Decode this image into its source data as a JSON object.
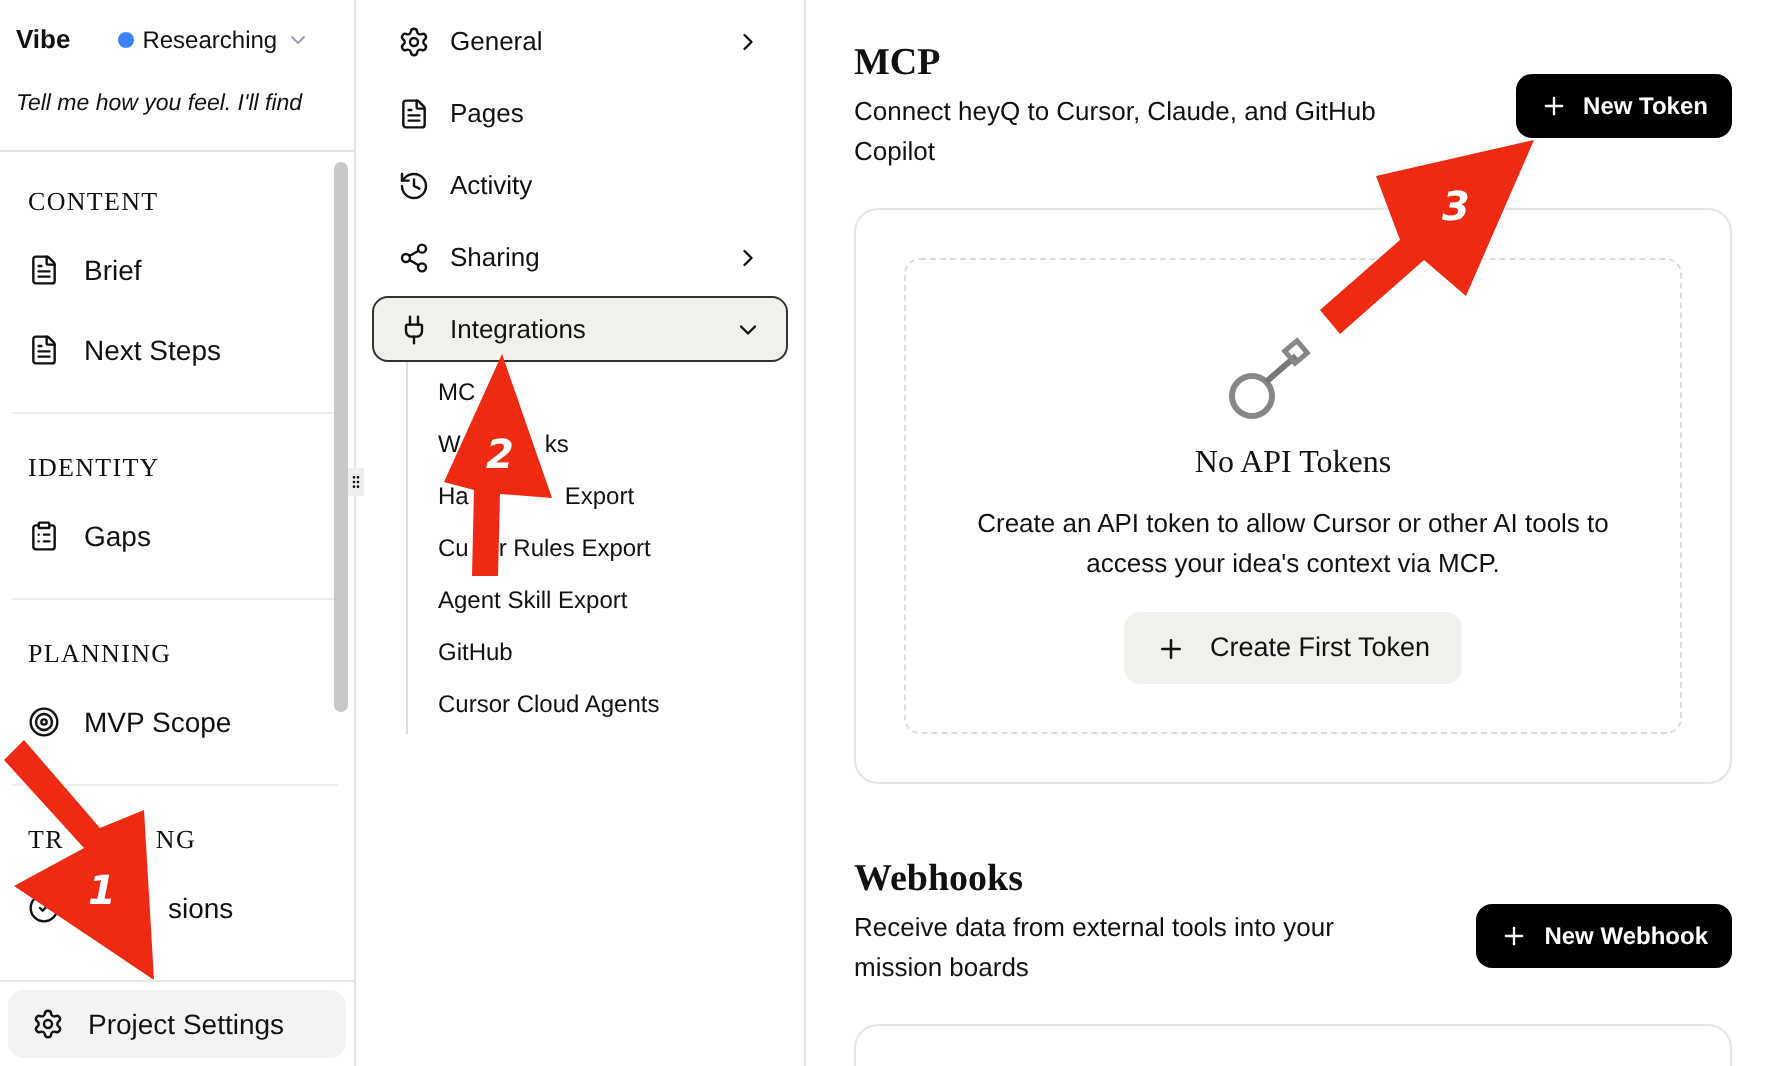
{
  "header": {
    "title": "Vibe",
    "status": {
      "label": "Researching",
      "color": "#3b82f6"
    },
    "tagline": "Tell me how you feel. I'll find"
  },
  "sidebar": {
    "sections": [
      {
        "title": "CONTENT",
        "items": [
          {
            "label": "Brief"
          },
          {
            "label": "Next Steps"
          }
        ]
      },
      {
        "title": "IDENTITY",
        "items": [
          {
            "label": "Gaps"
          }
        ]
      },
      {
        "title": "PLANNING",
        "items": [
          {
            "label": "MVP Scope"
          }
        ]
      },
      {
        "title_parts": [
          "TR",
          "NG"
        ],
        "items": [
          {
            "label_parts": [
              "sions"
            ],
            "covered_start": true
          }
        ]
      }
    ],
    "footer": {
      "label": "Project Settings"
    }
  },
  "settings_nav": {
    "items": [
      {
        "label": "General",
        "expanded": false,
        "selected": false
      },
      {
        "label": "Pages",
        "selected": false
      },
      {
        "label": "Activity",
        "selected": false
      },
      {
        "label": "Sharing",
        "expanded": false,
        "selected": false
      },
      {
        "label": "Integrations",
        "expanded": true,
        "selected": true,
        "children": [
          {
            "label": "MC"
          },
          {
            "label_parts": [
              "W",
              "ks"
            ]
          },
          {
            "label_parts": [
              "Ha",
              "Export"
            ]
          },
          {
            "label_parts": [
              "Cu",
              "r Rules Export"
            ]
          },
          {
            "label": "Agent Skill Export"
          },
          {
            "label": "GitHub"
          },
          {
            "label": "Cursor Cloud Agents"
          }
        ]
      }
    ]
  },
  "main": {
    "sections": [
      {
        "title": "MCP",
        "description": "Connect heyQ to Cursor, Claude, and GitHub Copilot",
        "button": "New Token",
        "empty": {
          "title": "No API Tokens",
          "text": "Create an API token to allow Cursor or other AI tools to access your idea's context via MCP.",
          "button": "Create First Token"
        }
      },
      {
        "title": "Webhooks",
        "description": "Receive data from external tools into your mission boards",
        "button": "New Webhook"
      }
    ]
  },
  "annotations": [
    {
      "label": "1"
    },
    {
      "label": "2"
    },
    {
      "label": "3"
    }
  ]
}
